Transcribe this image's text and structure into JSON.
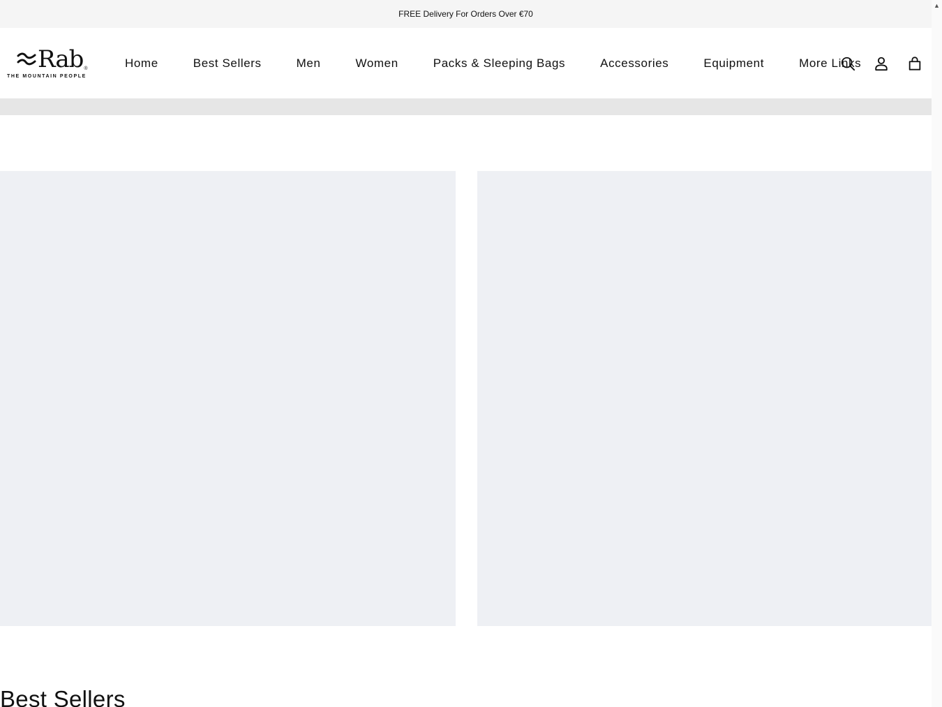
{
  "announcement": {
    "text": "FREE Delivery For Orders Over €70"
  },
  "logo": {
    "name": "Rab",
    "reg": "®",
    "tagline": "THE MOUNTAIN PEOPLE"
  },
  "nav": {
    "items": [
      {
        "label": "Home"
      },
      {
        "label": "Best Sellers"
      },
      {
        "label": "Men"
      },
      {
        "label": "Women"
      },
      {
        "label": "Packs & Sleeping Bags"
      },
      {
        "label": "Accessories"
      },
      {
        "label": "Equipment"
      },
      {
        "label": "More Links"
      }
    ]
  },
  "header_icons": [
    "search-icon",
    "account-icon",
    "cart-icon"
  ],
  "sections": {
    "best_sellers_title": "Best Sellers"
  },
  "scrollbar": {
    "up_glyph": "▲"
  },
  "colors": {
    "announcement_bg": "#f5f5f5",
    "banner_placeholder": "#eef0f4",
    "band": "#e6e6e6"
  }
}
